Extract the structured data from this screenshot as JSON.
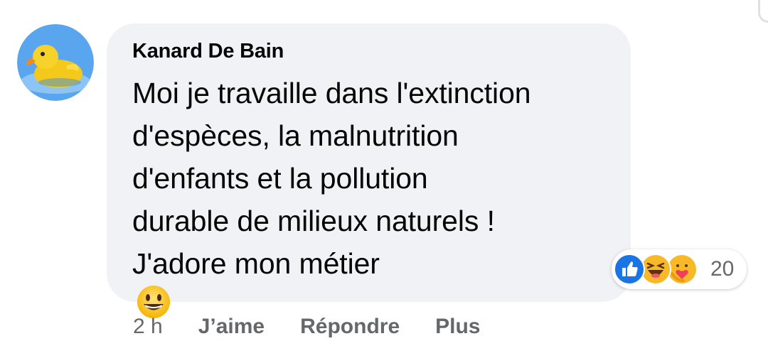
{
  "comment": {
    "author": "Kanard De Bain",
    "text_lines": [
      "Moi je travaille dans l'extinction",
      "d'espèces, la malnutrition",
      "d'enfants et la pollution",
      "durable de milieux naturels !",
      "J'adore mon métier"
    ],
    "emoji_icon": "grinning-face-icon",
    "avatar_icon": "rubber-duck-icon"
  },
  "reactions": {
    "icons": [
      "like-icon",
      "haha-icon",
      "care-icon"
    ],
    "count": "20"
  },
  "actions": {
    "timestamp": "2 h",
    "like_label": "J’aime",
    "reply_label": "Répondre",
    "more_label": "Plus"
  },
  "colors": {
    "bubble_bg": "#f0f2f5",
    "text": "#050505",
    "secondary_text": "#65676b",
    "like_blue": "#1b74e4"
  }
}
